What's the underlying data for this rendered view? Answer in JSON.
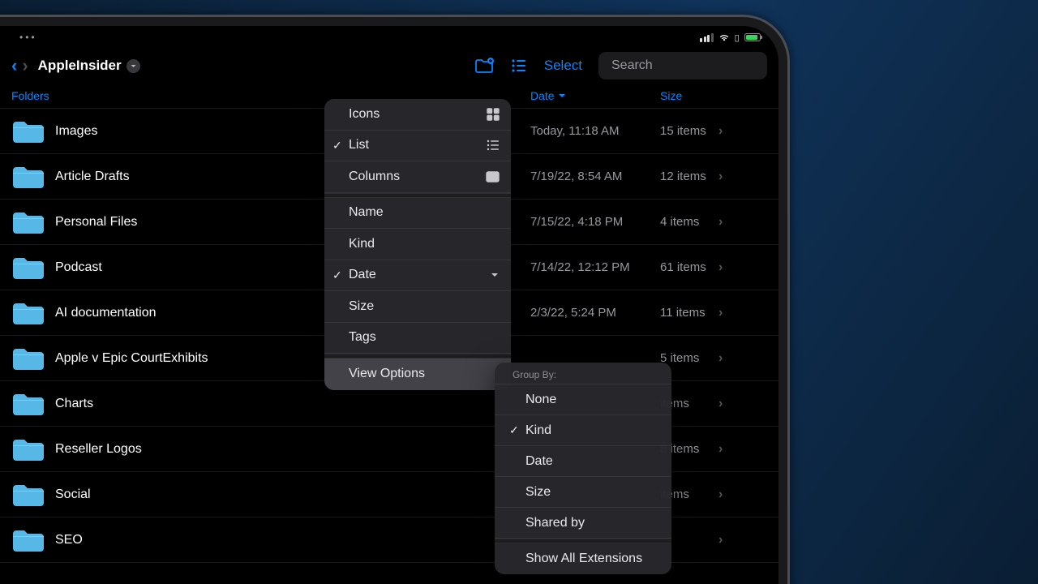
{
  "status": {
    "dots": "•••"
  },
  "nav": {
    "title": "AppleInsider",
    "select_label": "Select",
    "search_placeholder": "Search"
  },
  "columns": {
    "folders": "Folders",
    "date": "Date",
    "size": "Size"
  },
  "rows": [
    {
      "name": "Images",
      "date": "Today, 11:18 AM",
      "size": "15 items"
    },
    {
      "name": "Article Drafts",
      "date": "7/19/22, 8:54 AM",
      "size": "12 items"
    },
    {
      "name": "Personal Files",
      "date": "7/15/22, 4:18 PM",
      "size": "4 items"
    },
    {
      "name": "Podcast",
      "date": "7/14/22, 12:12 PM",
      "size": "61 items"
    },
    {
      "name": "AI documentation",
      "date": "2/3/22, 5:24 PM",
      "size": "11 items"
    },
    {
      "name": "Apple v Epic CourtExhibits",
      "date": "",
      "size": "5 items"
    },
    {
      "name": "Charts",
      "date": "",
      "size": "items"
    },
    {
      "name": "Reseller Logos",
      "date": "",
      "size": "8 items"
    },
    {
      "name": "Social",
      "date": "",
      "size": "items"
    },
    {
      "name": "SEO",
      "date": "",
      "size": ""
    }
  ],
  "viewMenu": {
    "icons": "Icons",
    "list": "List",
    "columns": "Columns",
    "name": "Name",
    "kind": "Kind",
    "date": "Date",
    "size": "Size",
    "tags": "Tags",
    "view_options": "View Options"
  },
  "groupMenu": {
    "header": "Group By:",
    "none": "None",
    "kind": "Kind",
    "date": "Date",
    "size": "Size",
    "shared": "Shared by",
    "show_ext": "Show All Extensions"
  }
}
